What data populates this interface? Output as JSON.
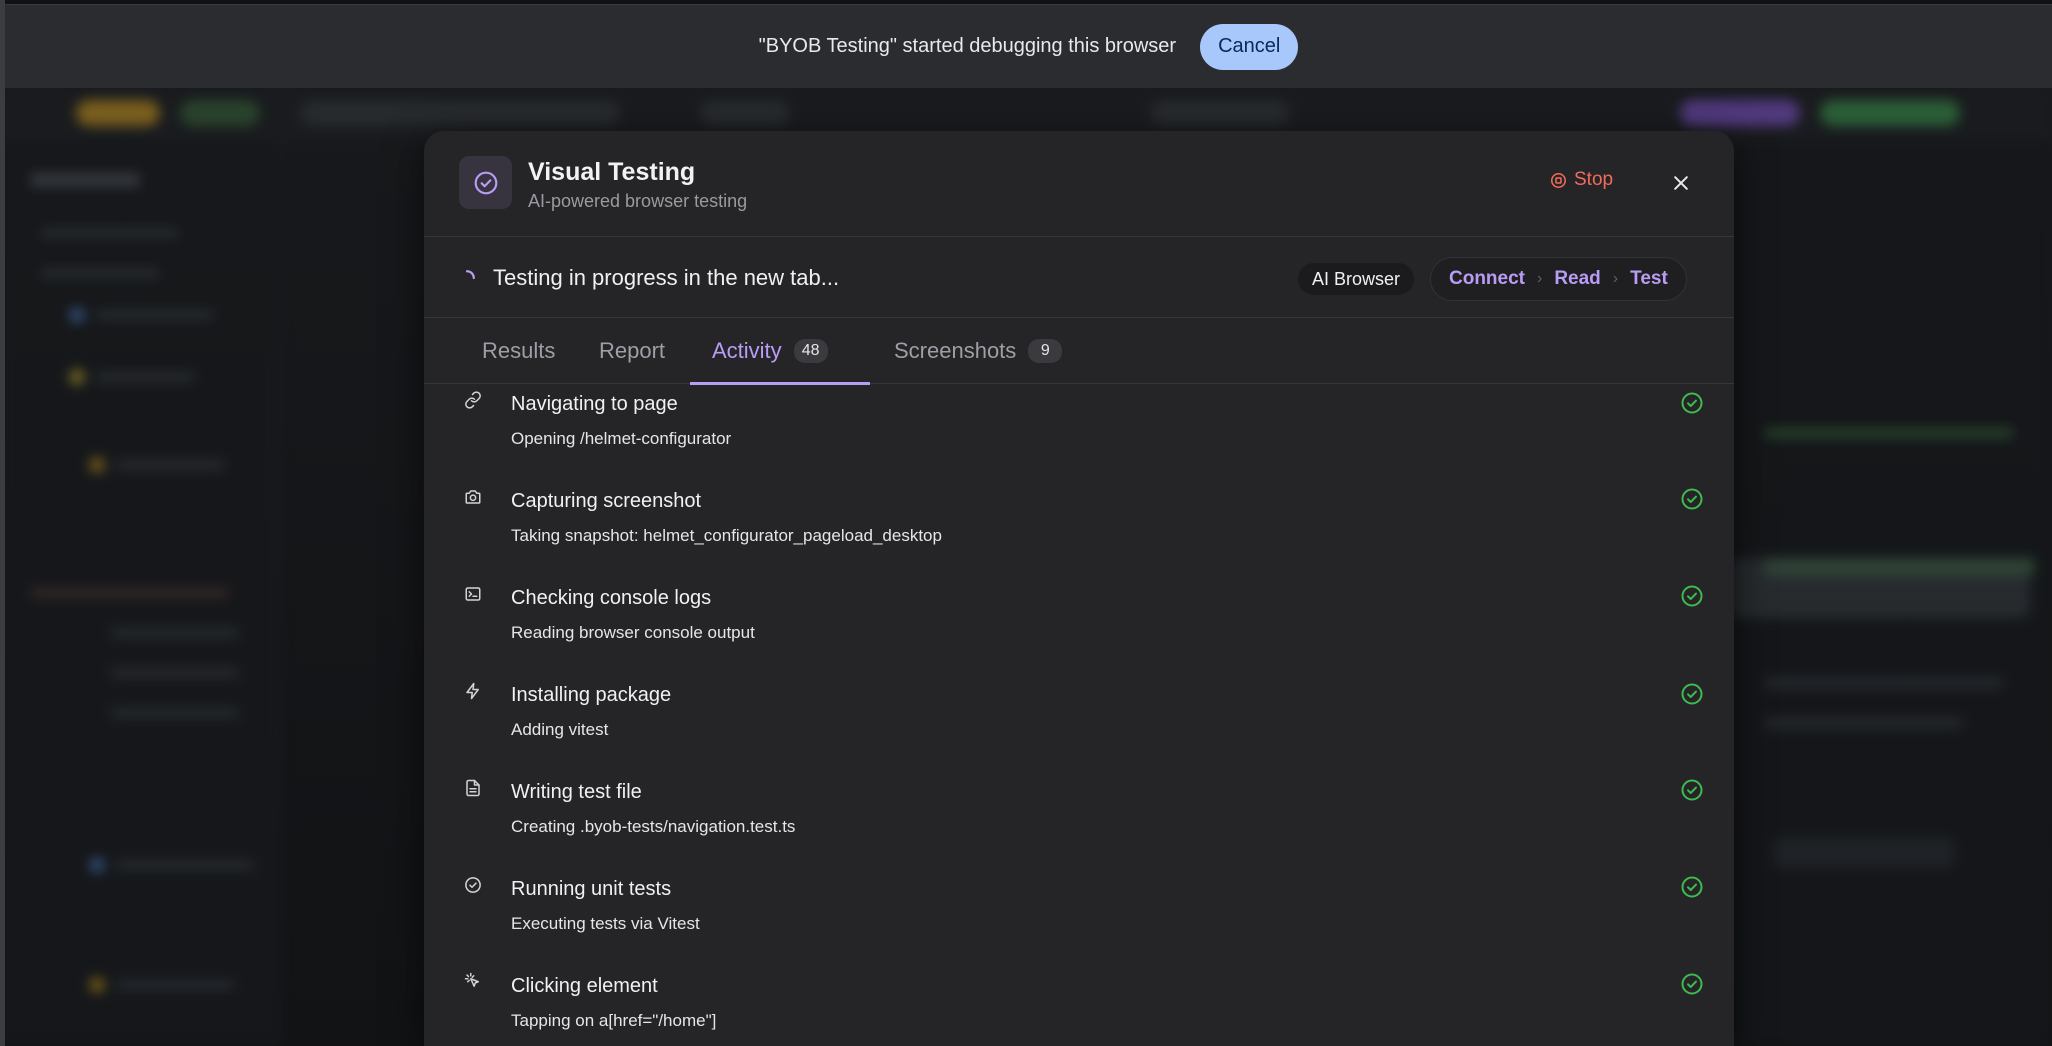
{
  "banner": {
    "message": "\"BYOB Testing\" started debugging this browser",
    "cancel_label": "Cancel"
  },
  "modal": {
    "title": "Visual Testing",
    "subtitle": "AI-powered browser testing",
    "stop_label": "Stop",
    "icons": {
      "app": "check-circle-icon",
      "stop": "stop-circle-icon",
      "close": "close-icon",
      "spinner": "spinner-icon"
    },
    "status_text": "Testing in progress in the new tab...",
    "mode_chip": "AI Browser",
    "steps": [
      "Connect",
      "Read",
      "Test"
    ]
  },
  "tabs": [
    {
      "label": "Results",
      "badge": null,
      "active": false
    },
    {
      "label": "Report",
      "badge": null,
      "active": false
    },
    {
      "label": "Activity",
      "badge": "48",
      "active": true
    },
    {
      "label": "Screenshots",
      "badge": "9",
      "active": false
    }
  ],
  "activity": [
    {
      "icon": "link-icon",
      "title": "Navigating to page",
      "description": "Opening /helmet-configurator",
      "status": "done"
    },
    {
      "icon": "camera-icon",
      "title": "Capturing screenshot",
      "description": "Taking snapshot: helmet_configurator_pageload_desktop",
      "status": "done"
    },
    {
      "icon": "terminal-icon",
      "title": "Checking console logs",
      "description": "Reading browser console output",
      "status": "done"
    },
    {
      "icon": "lightning-icon",
      "title": "Installing package",
      "description": "Adding vitest",
      "status": "done"
    },
    {
      "icon": "file-icon",
      "title": "Writing test file",
      "description": "Creating .byob-tests/navigation.test.ts",
      "status": "done"
    },
    {
      "icon": "check-circle-icon",
      "title": "Running unit tests",
      "description": "Executing tests via Vitest",
      "status": "done"
    },
    {
      "icon": "pointer-click-icon",
      "title": "Clicking element",
      "description": "Tapping on a[href=\"/home\"]",
      "status": "done"
    }
  ],
  "colors": {
    "accent": "#b99cf5",
    "stop": "#f16b5c",
    "success": "#3fb950",
    "banner_button": "#a8c7fa"
  }
}
